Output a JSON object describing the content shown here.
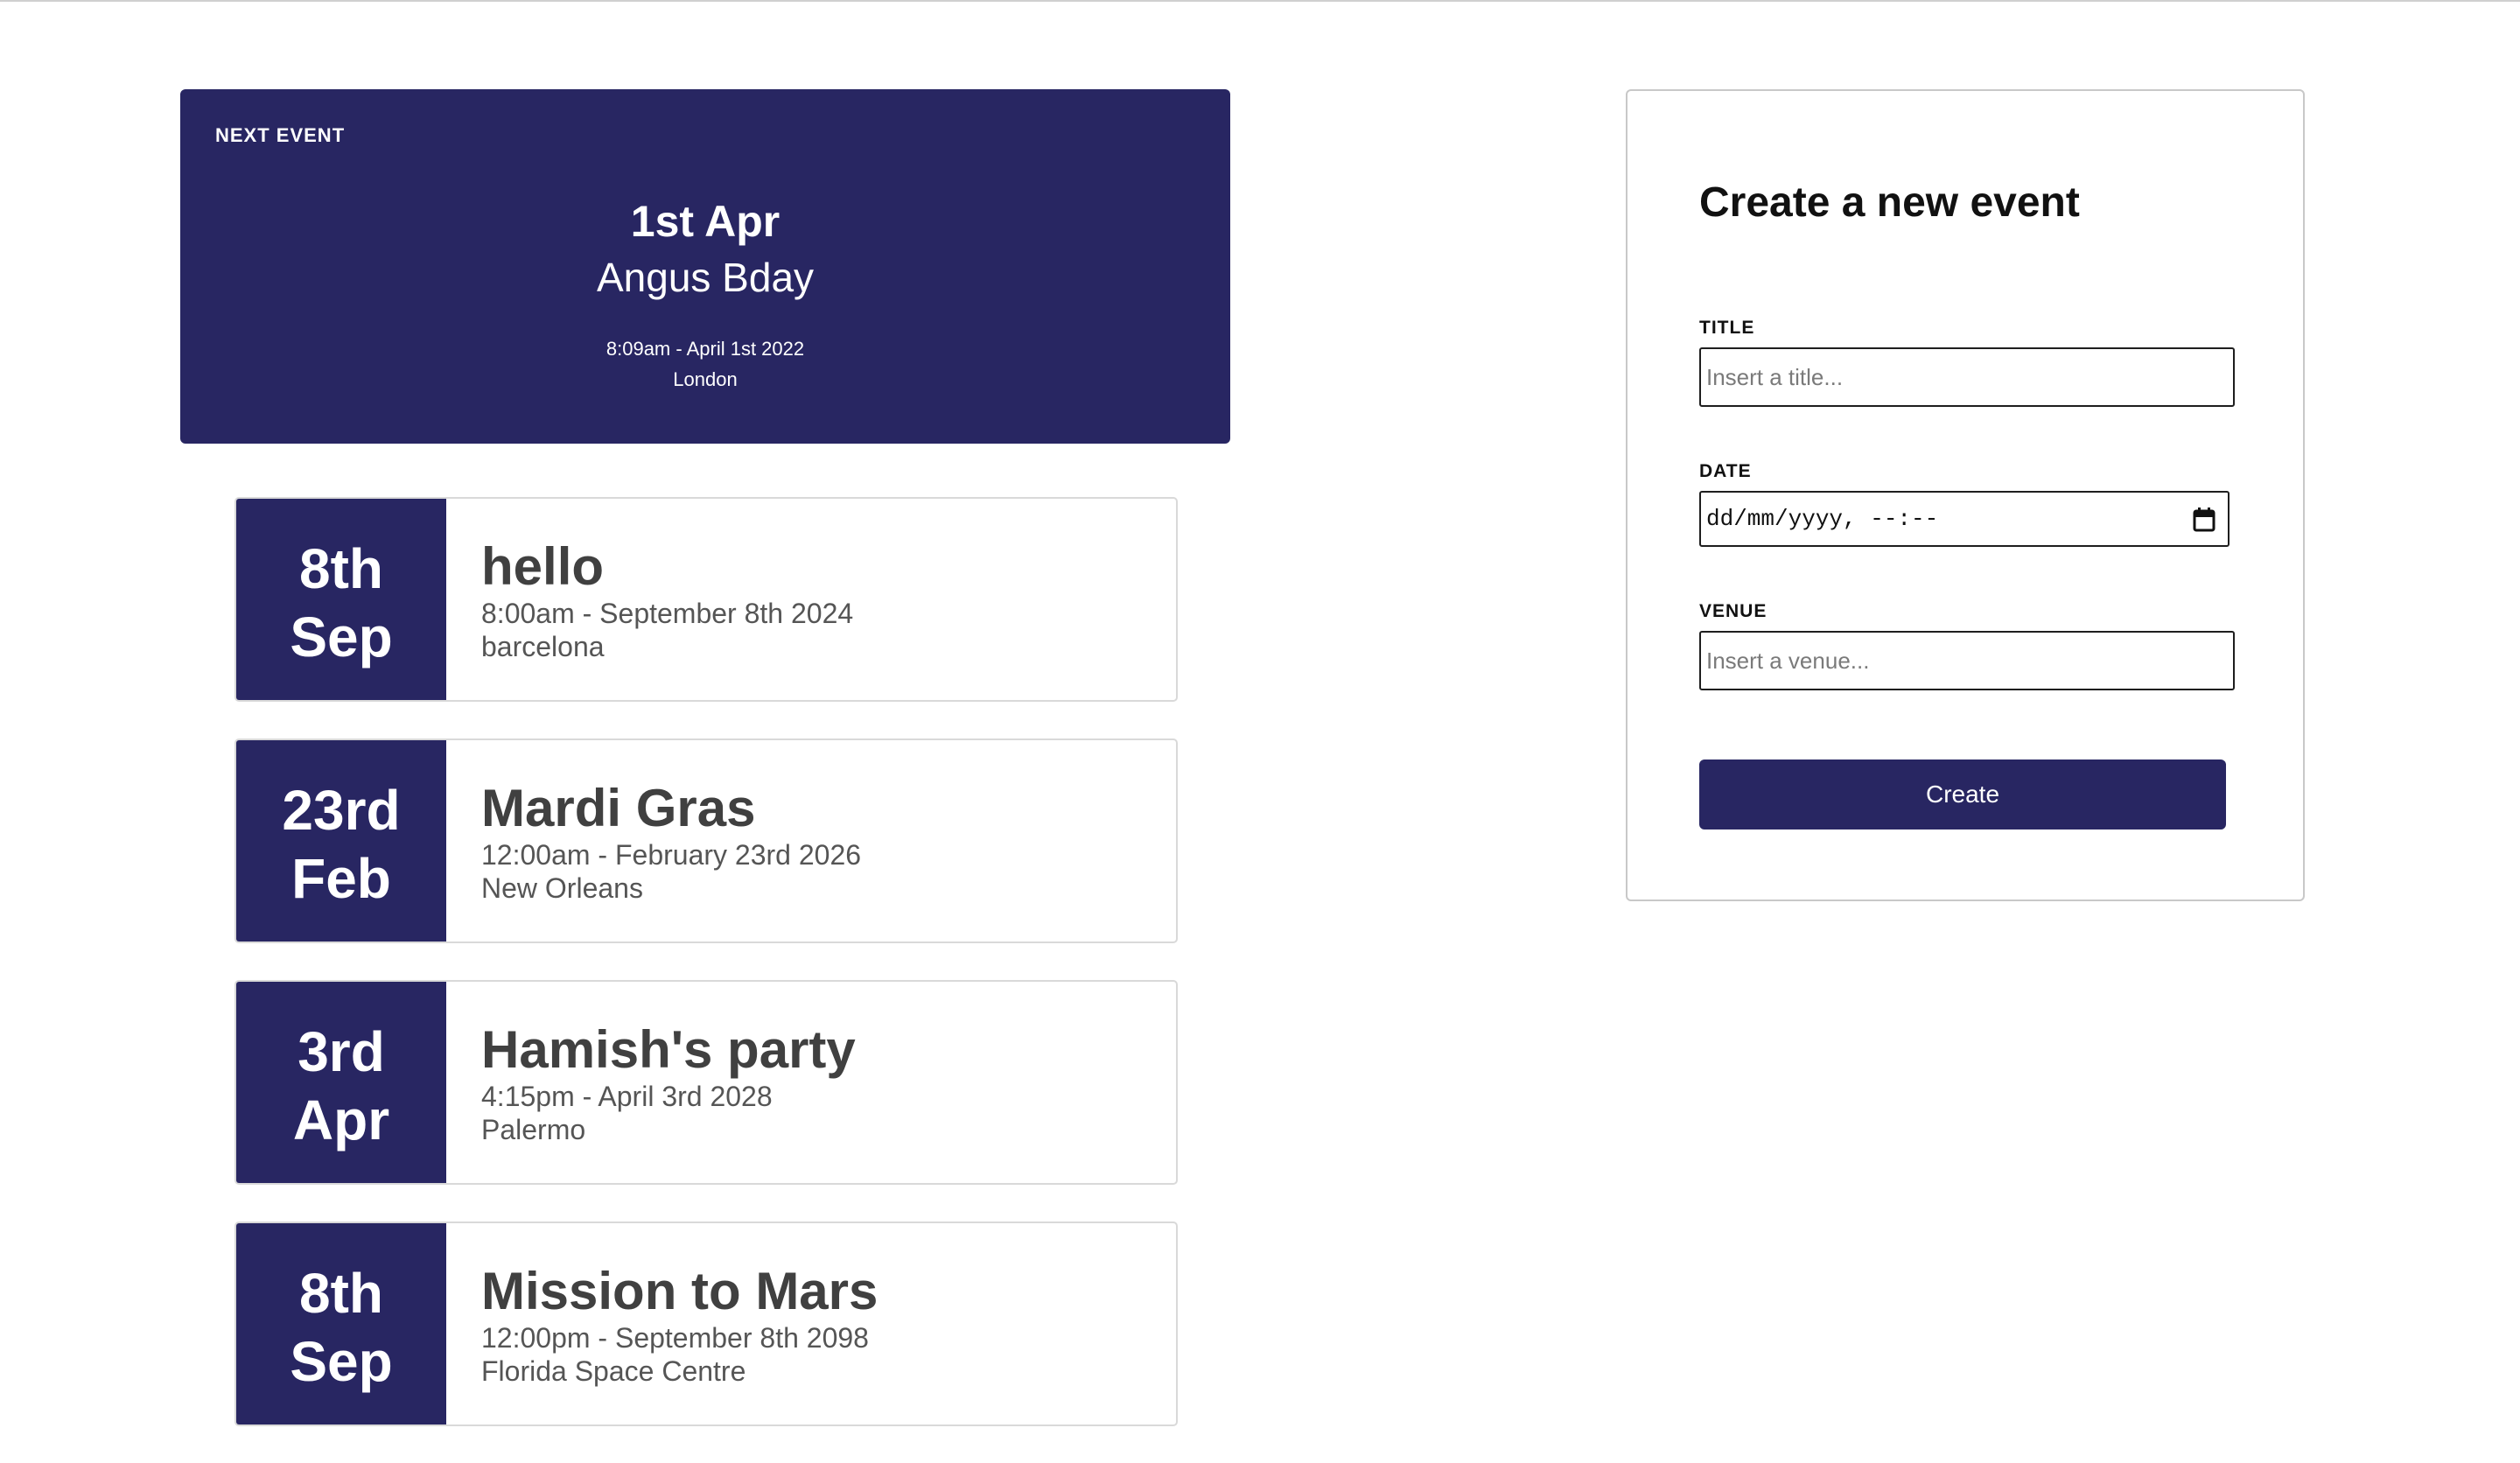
{
  "next_event": {
    "kicker": "NEXT EVENT",
    "date": "1st Apr",
    "title": "Angus Bday",
    "time": "8:09am - April 1st 2022",
    "venue": "London"
  },
  "events": [
    {
      "day": "8th",
      "month": "Sep",
      "title": "hello",
      "time": "8:00am - September 8th 2024",
      "venue": "barcelona"
    },
    {
      "day": "23rd",
      "month": "Feb",
      "title": "Mardi Gras",
      "time": "12:00am - February 23rd 2026",
      "venue": "New Orleans"
    },
    {
      "day": "3rd",
      "month": "Apr",
      "title": "Hamish's party",
      "time": "4:15pm - April 3rd 2028",
      "venue": "Palermo"
    },
    {
      "day": "8th",
      "month": "Sep",
      "title": "Mission to Mars",
      "time": "12:00pm - September 8th 2098",
      "venue": "Florida Space Centre"
    }
  ],
  "form": {
    "heading": "Create a new event",
    "title_label": "TITLE",
    "title_placeholder": "Insert a title...",
    "date_label": "DATE",
    "date_value": "dd/mm/yyyy, --:--",
    "venue_label": "VENUE",
    "venue_placeholder": "Insert a venue...",
    "submit_label": "Create"
  },
  "colors": {
    "accent": "#282662",
    "card_border": "#d9d9d9",
    "text_dark": "#404040"
  },
  "icons": {
    "date_picker": "calendar-icon"
  }
}
